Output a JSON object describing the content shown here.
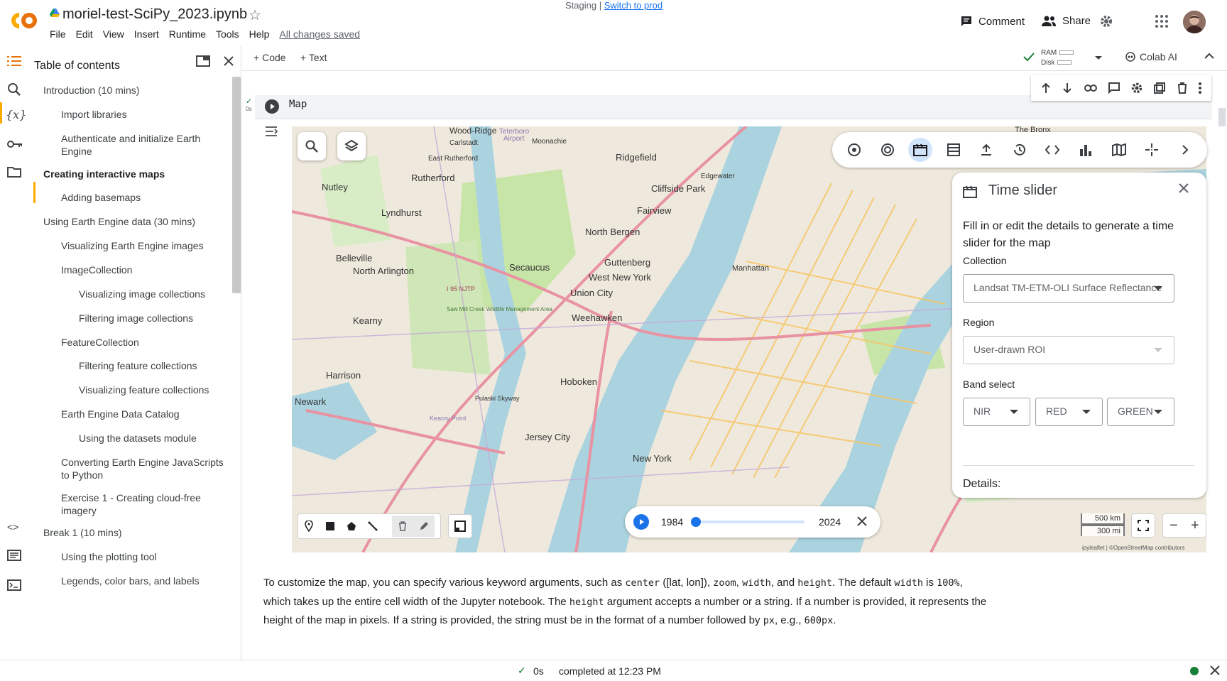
{
  "header": {
    "title": "moriel-test-SciPy_2023.ipynb",
    "menu": [
      "File",
      "Edit",
      "View",
      "Insert",
      "Runtime",
      "Tools",
      "Help"
    ],
    "saved": "All changes saved",
    "staging": "Staging",
    "staging_sep": " | ",
    "switch_link": "Switch to prod",
    "comment": "Comment",
    "share": "Share"
  },
  "toc": {
    "title": "Table of contents",
    "items": [
      "Introduction (10 mins)",
      "Import libraries",
      "Authenticate and initialize Earth Engine",
      "Creating interactive maps",
      "Adding basemaps",
      "Using Earth Engine data (30 mins)",
      "Visualizing Earth Engine images",
      "ImageCollection",
      "Visualizing image collections",
      "Filtering image collections",
      "FeatureCollection",
      "Filtering feature collections",
      "Visualizing feature collections",
      "Earth Engine Data Catalog",
      "Using the datasets module",
      "Converting Earth Engine JavaScripts to Python",
      "Exercise 1 - Creating cloud-free imagery",
      "Break 1 (10 mins)",
      "Using the plotting tool",
      "Legends, color bars, and labels"
    ]
  },
  "toolbar": {
    "code": "Code",
    "text": "Text",
    "ram": "RAM",
    "disk": "Disk",
    "colab_ai": "Colab AI"
  },
  "cell": {
    "code": "Map",
    "time": "0s"
  },
  "time_slider": {
    "title": "Time slider",
    "description": "Fill in or edit the details to generate a time slider for the map",
    "collection_label": "Collection",
    "collection_value": "Landsat TM-ETM-OLI Surface Reflectance",
    "region_label": "Region",
    "region_value": "User-drawn ROI",
    "band_label": "Band select",
    "bands": [
      "NIR",
      "RED",
      "GREEN"
    ],
    "details_label": "Details:"
  },
  "slider": {
    "start": "1984",
    "end": "2024",
    "position": 0
  },
  "map": {
    "scale_km": "500 km",
    "scale_mi": "300 mi",
    "attribution": "ipyleaflet | ©OpenStreetMap contributors",
    "places": [
      "Wood-Ridge",
      "Teterboro",
      "Airport",
      "Carlstadt",
      "Moonachie",
      "East Rutherford",
      "Rutherford",
      "Ridgefield",
      "Edgewater",
      "Cliffside Park",
      "Nutley",
      "Lyndhurst",
      "Fairview",
      "North Bergen",
      "Belleville",
      "North Arlington",
      "Secaucus",
      "Guttenberg",
      "West New York",
      "Manhattan",
      "Union City",
      "Weehawken",
      "Kearny",
      "Harrison",
      "Newark",
      "Hoboken",
      "Jersey City",
      "New York",
      "The Bronx",
      "Pulaski Skyway",
      "Kearny Point",
      "I 95 NJTP",
      "Saw Mill Creek Wildlife Management Area"
    ],
    "colors": {
      "water": "#aad3df",
      "land": "#efe9dd",
      "motorway": "#e892a2",
      "park": "#c8e5a8"
    }
  },
  "text_cell": {
    "p1": "To customize the map, you can specify various keyword arguments, such as ",
    "c_center": "center",
    "p2": " ([lat, lon]), ",
    "c_zoom": "zoom",
    "p3": ", ",
    "c_width": "width",
    "p4": ", and ",
    "c_height": "height",
    "p5": ". The default ",
    "c_width2": "width",
    "p6": " is ",
    "c_100": "100%",
    "p7": ", which takes up the entire cell width of the Jupyter notebook. The ",
    "c_height2": "height",
    "p8": " argument accepts a number or a string. If a number is provided, it represents the height of the map in pixels. If a string is provided, the string must be in the format of a number followed by ",
    "c_px": "px",
    "p9": ", e.g., ",
    "c_600": "600px",
    "p10": "."
  },
  "status": {
    "time": "0s",
    "completed": "completed at 12:23 PM"
  }
}
